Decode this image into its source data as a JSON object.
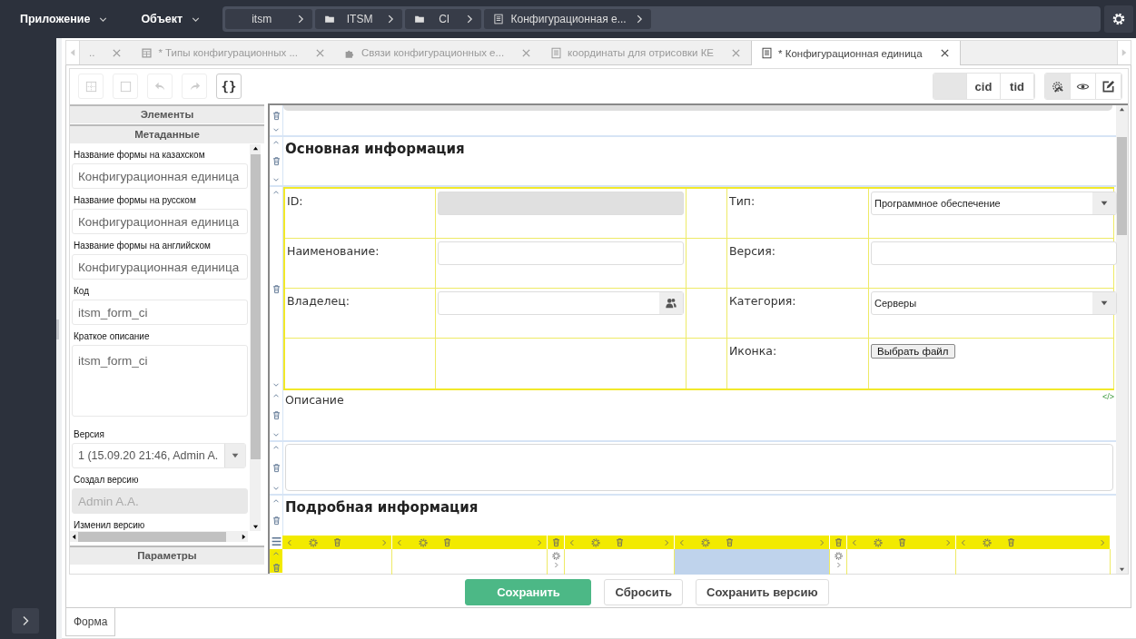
{
  "top_bar": {
    "menus": [
      {
        "label": "Приложение"
      },
      {
        "label": "Объект"
      }
    ],
    "breadcrumbs": [
      {
        "label": "itsm"
      },
      {
        "label": "ITSM"
      },
      {
        "label": "CI"
      },
      {
        "label": "Конфигурационная е..."
      }
    ]
  },
  "tabs": [
    {
      "label": "..",
      "selected": false
    },
    {
      "label": "* Типы конфигурационных ...",
      "selected": false
    },
    {
      "label": "Связи конфигурационных е...",
      "selected": false
    },
    {
      "label": "координаты для отрисовки КЕ",
      "selected": false
    },
    {
      "label": "* Конфигурационная единица",
      "selected": true
    }
  ],
  "toolbar": {
    "left_tools": [
      {
        "kind": "icon",
        "disabled": true
      },
      {
        "kind": "icon",
        "disabled": true
      },
      {
        "kind": "icon",
        "disabled": true
      },
      {
        "kind": "icon",
        "disabled": true
      },
      {
        "kind": "text",
        "label": "{}",
        "disabled": false
      }
    ],
    "id_toggles": [
      {
        "kind": "blank",
        "selected": true
      },
      {
        "kind": "text",
        "label": "cid",
        "selected": false
      },
      {
        "kind": "text",
        "label": "tid",
        "selected": false
      }
    ],
    "view_modes": [
      {
        "selected": true
      },
      {
        "selected": false
      },
      {
        "selected": false
      }
    ]
  },
  "sidebar": {
    "sections": [
      {
        "title": "Элементы"
      },
      {
        "title": "Метаданные"
      }
    ],
    "fields": [
      {
        "label": "Название формы на казахском",
        "kind": "input",
        "value": "Конфигурационная единица"
      },
      {
        "label": "Название формы на русском",
        "kind": "input",
        "value": "Конфигурационная единица"
      },
      {
        "label": "Название формы на английском",
        "kind": "input",
        "value": "Конфигурационная единица"
      },
      {
        "label": "Код",
        "kind": "input",
        "value": "itsm_form_ci"
      },
      {
        "label": "Краткое описание",
        "kind": "textarea",
        "value": "itsm_form_ci"
      },
      {
        "label": "Версия",
        "kind": "select",
        "value": "1 (15.09.20 21:46, Admin A."
      },
      {
        "label": "Создал версию",
        "kind": "readonly",
        "value": "Admin A.A."
      },
      {
        "label": "Изменил версию",
        "kind": "label"
      }
    ],
    "footer_section": "Параметры"
  },
  "canvas": {
    "blocks": [
      {
        "kind": "blank"
      },
      {
        "kind": "heading",
        "text": "Основная информация"
      },
      {
        "kind": "grid",
        "rows": [
          {
            "left": {
              "label": "ID:",
              "kind": "readonly"
            },
            "right": {
              "label": "Тип:",
              "kind": "select",
              "value": "Программное обеспечение"
            }
          },
          {
            "left": {
              "label": "Наименование:",
              "kind": "input"
            },
            "right": {
              "label": "Версия:",
              "kind": "input"
            }
          },
          {
            "left": {
              "label": "Владелец:",
              "kind": "user_input"
            },
            "right": {
              "label": "Категория:",
              "kind": "select",
              "value": "Серверы"
            }
          },
          {
            "right": {
              "label": "Иконка:",
              "kind": "file",
              "value": "Выбрать файл"
            }
          }
        ]
      },
      {
        "kind": "text",
        "text": "Описание",
        "code_marker": "</>"
      },
      {
        "kind": "textarea"
      },
      {
        "kind": "heading",
        "text": "Подробная информация"
      },
      {
        "kind": "columns",
        "columns": [
          {
            "kind": "column",
            "selected": false
          },
          {
            "kind": "column",
            "selected": false
          },
          {
            "kind": "spacer",
            "selected": false
          },
          {
            "kind": "column",
            "selected": false
          },
          {
            "kind": "column",
            "selected": true
          },
          {
            "kind": "spacer",
            "selected": false
          },
          {
            "kind": "column",
            "selected": false
          },
          {
            "kind": "column",
            "selected": false
          }
        ]
      }
    ]
  },
  "buttons": [
    {
      "label": "Сохранить",
      "kind": "primary"
    },
    {
      "label": "Сбросить",
      "kind": "default"
    },
    {
      "label": "Сохранить версию",
      "kind": "default"
    }
  ],
  "bottom_tabs": [
    {
      "label": "Форма",
      "selected": true
    }
  ]
}
